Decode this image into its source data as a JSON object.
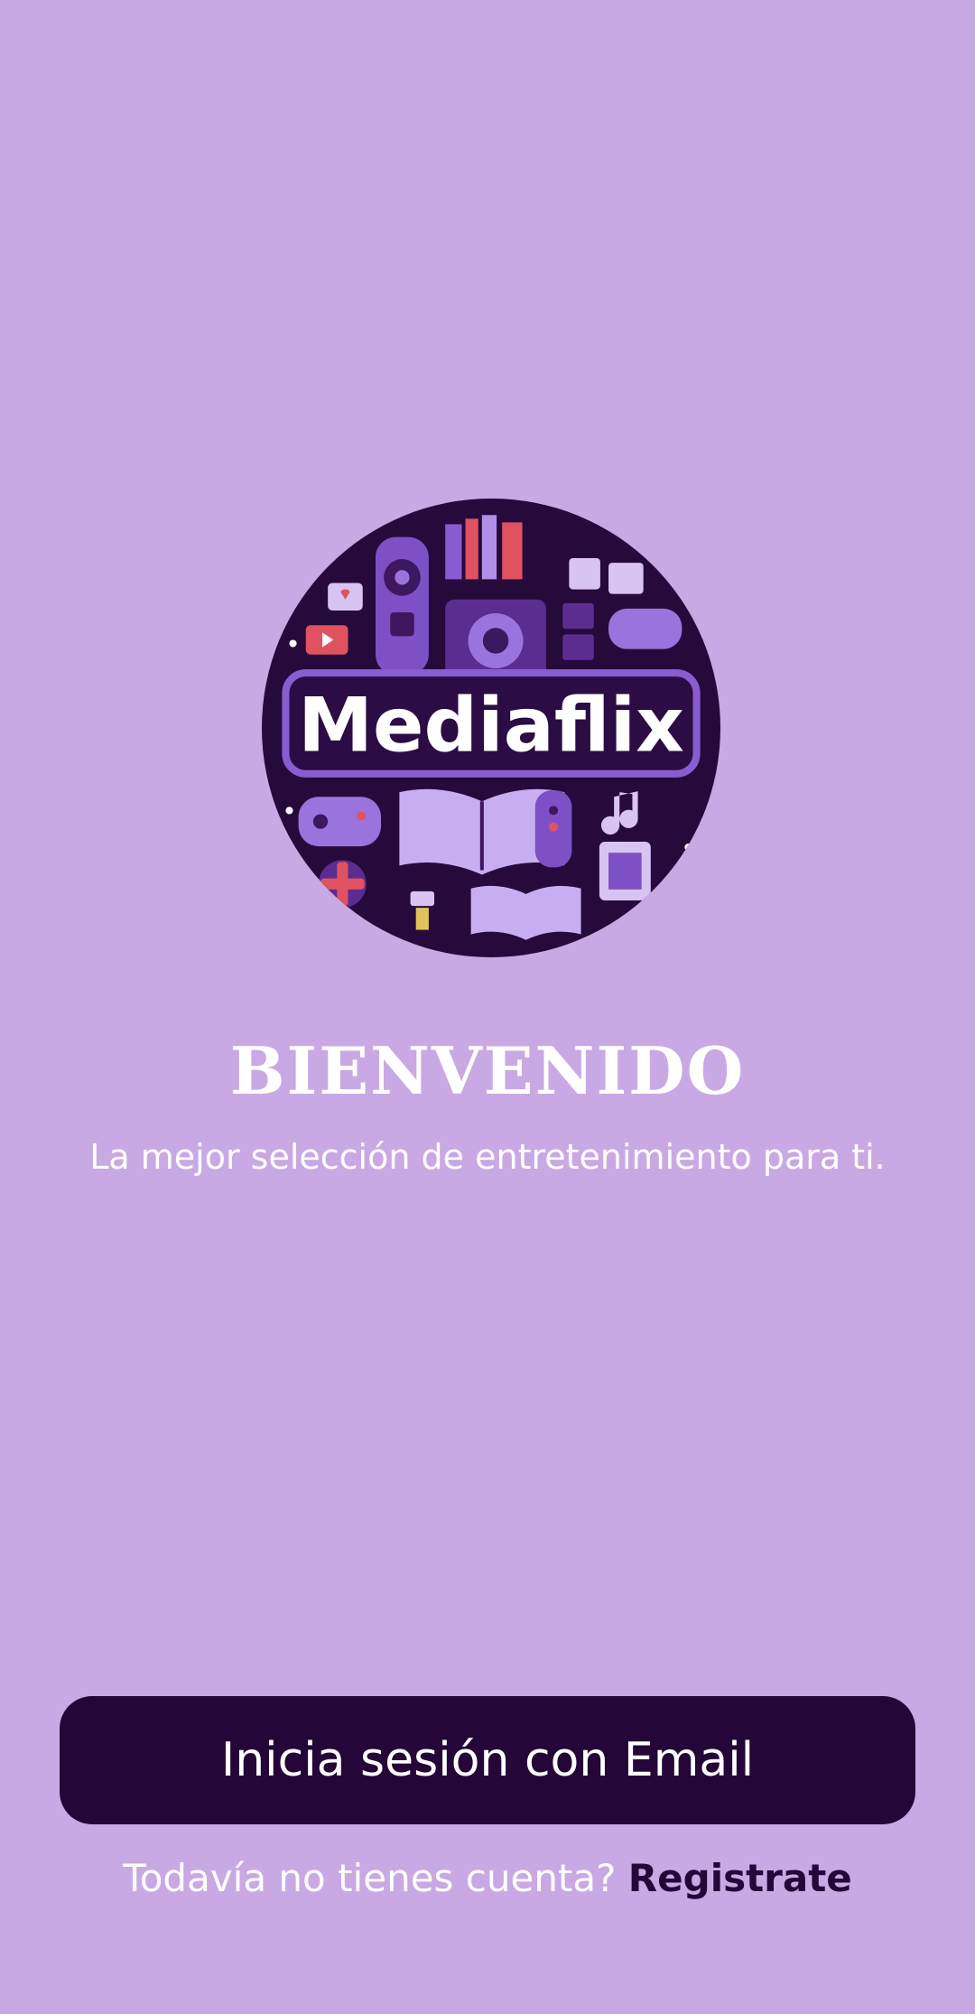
{
  "logo": {
    "text": "Mediaflix",
    "background_color": "#260a3b",
    "accent_color": "#8a5cd1"
  },
  "welcome": {
    "title": "BIENVENIDO",
    "subtitle": "La mejor selección de entretenimiento para ti."
  },
  "login_button": {
    "label": "Inicia sesión con Email"
  },
  "signup": {
    "prompt": "Todavía no tienes cuenta?",
    "link_label": "Registrate"
  },
  "colors": {
    "page_background": "#c9a9e3",
    "button_background": "#240738",
    "text_light": "#ffffff"
  }
}
